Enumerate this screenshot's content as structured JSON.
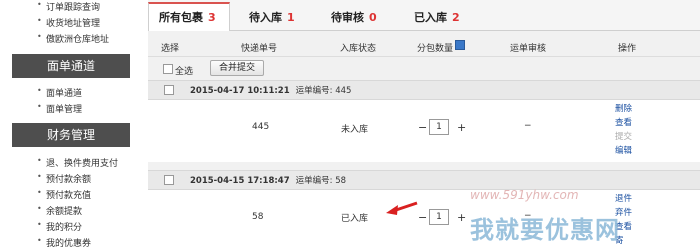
{
  "sidebar": {
    "top_links": [
      "订单跟踪查询",
      "收货地址管理",
      "傲欧洲仓库地址"
    ],
    "section_channel": "面单通道",
    "channel_links": [
      "面单通道",
      "面单管理"
    ],
    "section_finance": "财务管理",
    "finance_links": [
      "退、换件费用支付",
      "预付款余额",
      "预付款充值",
      "余额提款",
      "我的积分",
      "我的优惠券"
    ]
  },
  "tabs": [
    {
      "label": "所有包裹",
      "count": "3"
    },
    {
      "label": "待入库",
      "count": "1"
    },
    {
      "label": "待审核",
      "count": "0"
    },
    {
      "label": "已入库",
      "count": "2"
    }
  ],
  "columns": [
    "选择",
    "快递单号",
    "入库状态",
    "分包数量",
    "运单审核",
    "操作"
  ],
  "toolbar": {
    "select_all": "全选",
    "merge_button": "合并提交"
  },
  "groups": [
    {
      "datetime": "2015-04-17 10:11:21",
      "waybill_label": "运单编号: 445",
      "tracking": "445",
      "status": "未入库",
      "qty": "1",
      "minus": "−",
      "plus": "+",
      "review": "−",
      "actions": [
        "删除",
        "查看",
        "提交",
        "编辑"
      ]
    },
    {
      "datetime": "2015-04-15 17:18:47",
      "waybill_label": "运单编号: 58",
      "tracking": "58",
      "status": "已入库",
      "qty": "1",
      "minus": "−",
      "plus": "+",
      "review": "−",
      "actions": [
        "退件",
        "弃件",
        "查看",
        "寄"
      ]
    }
  ],
  "watermark": {
    "url": "www.591yhw.com",
    "text": "我就要优惠网"
  },
  "colors": {
    "tab_accent": "#d9534f",
    "count_red": "#dd3333",
    "link_blue": "#1a4fa0",
    "sidebar_head": "#4e4e4e",
    "arrow": "#d92020"
  }
}
